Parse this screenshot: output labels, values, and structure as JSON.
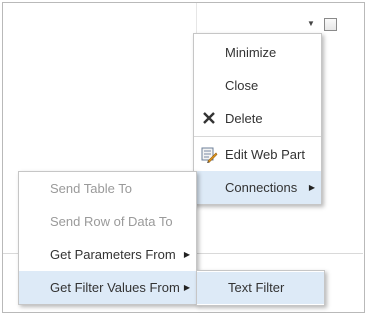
{
  "webpart": {
    "dropdown_icon": "dropdown-arrow-icon",
    "selection_checkbox": "checkbox"
  },
  "menu_main": {
    "items": [
      {
        "label": "Minimize"
      },
      {
        "label": "Close"
      },
      {
        "label": "Delete",
        "icon": "x-delete-icon"
      },
      {
        "label": "Edit Web Part",
        "icon": "edit-web-part-icon"
      },
      {
        "label": "Connections",
        "has_submenu": true
      }
    ]
  },
  "menu_connections": {
    "items": [
      {
        "label": "Send Table To",
        "disabled": true
      },
      {
        "label": "Send Row of Data To",
        "disabled": true
      },
      {
        "label": "Get Parameters From",
        "has_submenu": true
      },
      {
        "label": "Get Filter Values From",
        "has_submenu": true
      }
    ]
  },
  "menu_filter": {
    "items": [
      {
        "label": "Text Filter"
      }
    ]
  },
  "colors": {
    "highlight": "#ddeaf7",
    "disabled_text": "#9a9a9a",
    "text": "#333333"
  }
}
